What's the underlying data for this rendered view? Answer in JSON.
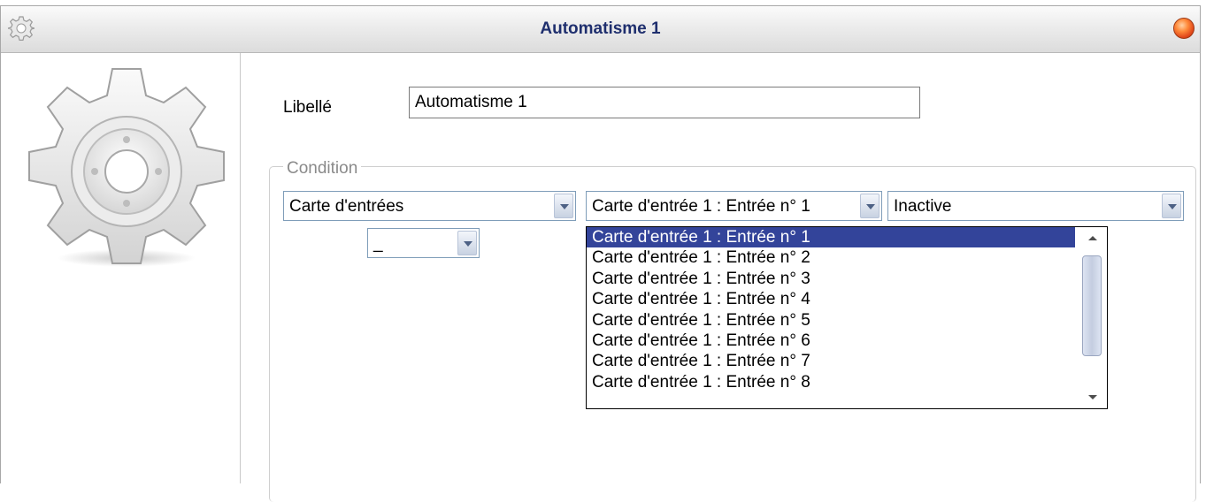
{
  "window": {
    "title": "Automatisme 1",
    "icon": "gear-icon",
    "close_icon": "close-icon",
    "accent_title_color": "#1f2f6e",
    "close_color": "#e0461a"
  },
  "left_panel": {
    "illustration": "gear-icon"
  },
  "form": {
    "label_libelle": "Libellé",
    "libelle_value": "Automatisme 1",
    "group_condition": "Condition",
    "combo_source": "Carte d'entrées",
    "combo_input": "Carte d'entrée 1 : Entrée n° 1",
    "combo_state": "Inactive",
    "combo_operator": "_"
  },
  "dropdown": {
    "selected_index": 0,
    "selected_color": "#33449a",
    "items": [
      "Carte d'entrée 1 : Entrée n° 1",
      "Carte d'entrée 1 : Entrée n° 2",
      "Carte d'entrée 1 : Entrée n° 3",
      "Carte d'entrée 1 : Entrée n° 4",
      "Carte d'entrée 1 : Entrée n° 5",
      "Carte d'entrée 1 : Entrée n° 6",
      "Carte d'entrée 1 : Entrée n° 7",
      "Carte d'entrée 1 : Entrée n° 8"
    ]
  }
}
